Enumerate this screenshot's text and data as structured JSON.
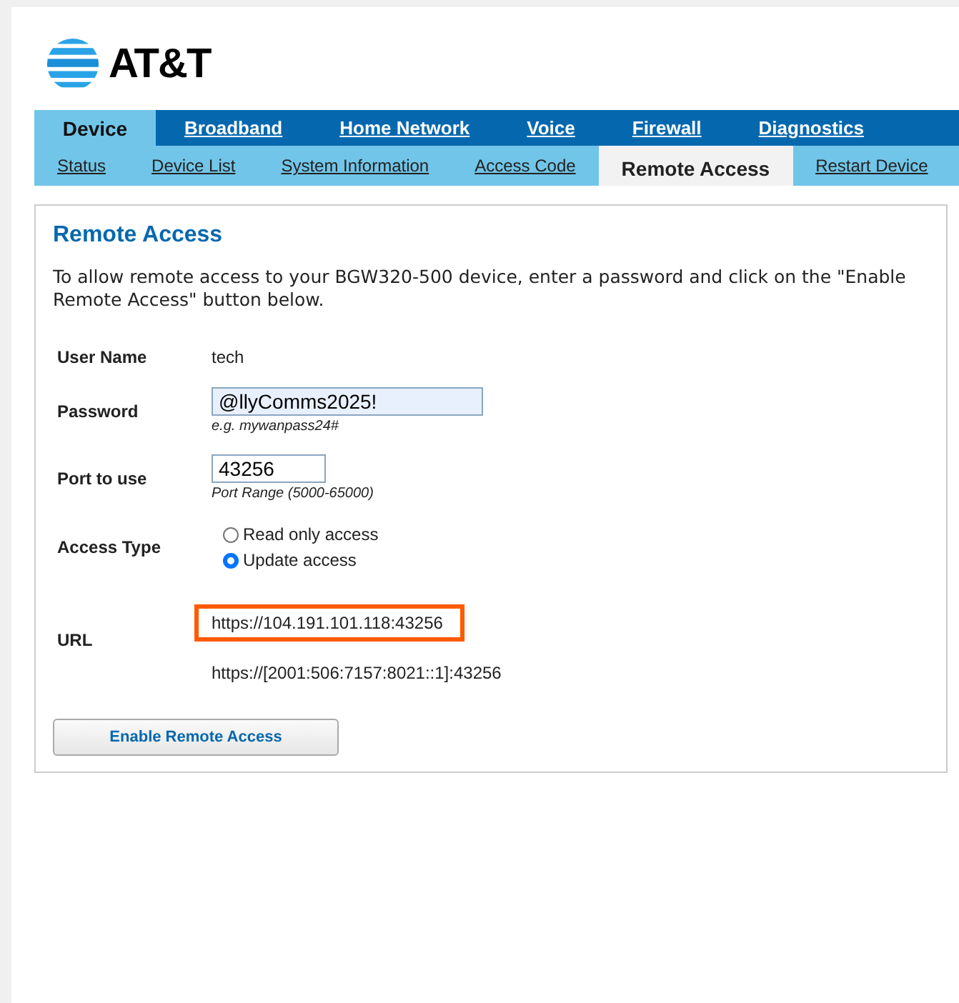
{
  "logo": {
    "text": "AT&T"
  },
  "main_tabs": [
    {
      "label": "Device",
      "selected": true
    },
    {
      "label": "Broadband",
      "selected": false
    },
    {
      "label": "Home Network",
      "selected": false
    },
    {
      "label": "Voice",
      "selected": false
    },
    {
      "label": "Firewall",
      "selected": false
    },
    {
      "label": "Diagnostics",
      "selected": false
    }
  ],
  "sub_tabs": [
    {
      "label": "Status",
      "selected": false
    },
    {
      "label": "Device List",
      "selected": false
    },
    {
      "label": "System Information",
      "selected": false
    },
    {
      "label": "Access Code",
      "selected": false
    },
    {
      "label": "Remote Access",
      "selected": true
    },
    {
      "label": "Restart Device",
      "selected": false
    }
  ],
  "panel": {
    "title": "Remote Access",
    "intro": "To allow remote access to your BGW320-500 device, enter a password and click on the \"Enable Remote Access\" button below.",
    "user_name": {
      "label": "User Name",
      "value": "tech"
    },
    "password": {
      "label": "Password",
      "value": "@llyComms2025!",
      "hint": "e.g. mywanpass24#"
    },
    "port": {
      "label": "Port to use",
      "value": "43256",
      "hint": "Port Range (5000-65000)"
    },
    "access_type": {
      "label": "Access Type",
      "options": [
        {
          "label": "Read only access",
          "selected": false
        },
        {
          "label": "Update access",
          "selected": true
        }
      ]
    },
    "url": {
      "label": "URL",
      "values": [
        {
          "text": "https://104.191.101.118:43256",
          "highlighted": true
        },
        {
          "text": "https://[2001:506:7157:8021::1]:43256",
          "highlighted": false
        }
      ]
    },
    "button": "Enable Remote Access"
  }
}
